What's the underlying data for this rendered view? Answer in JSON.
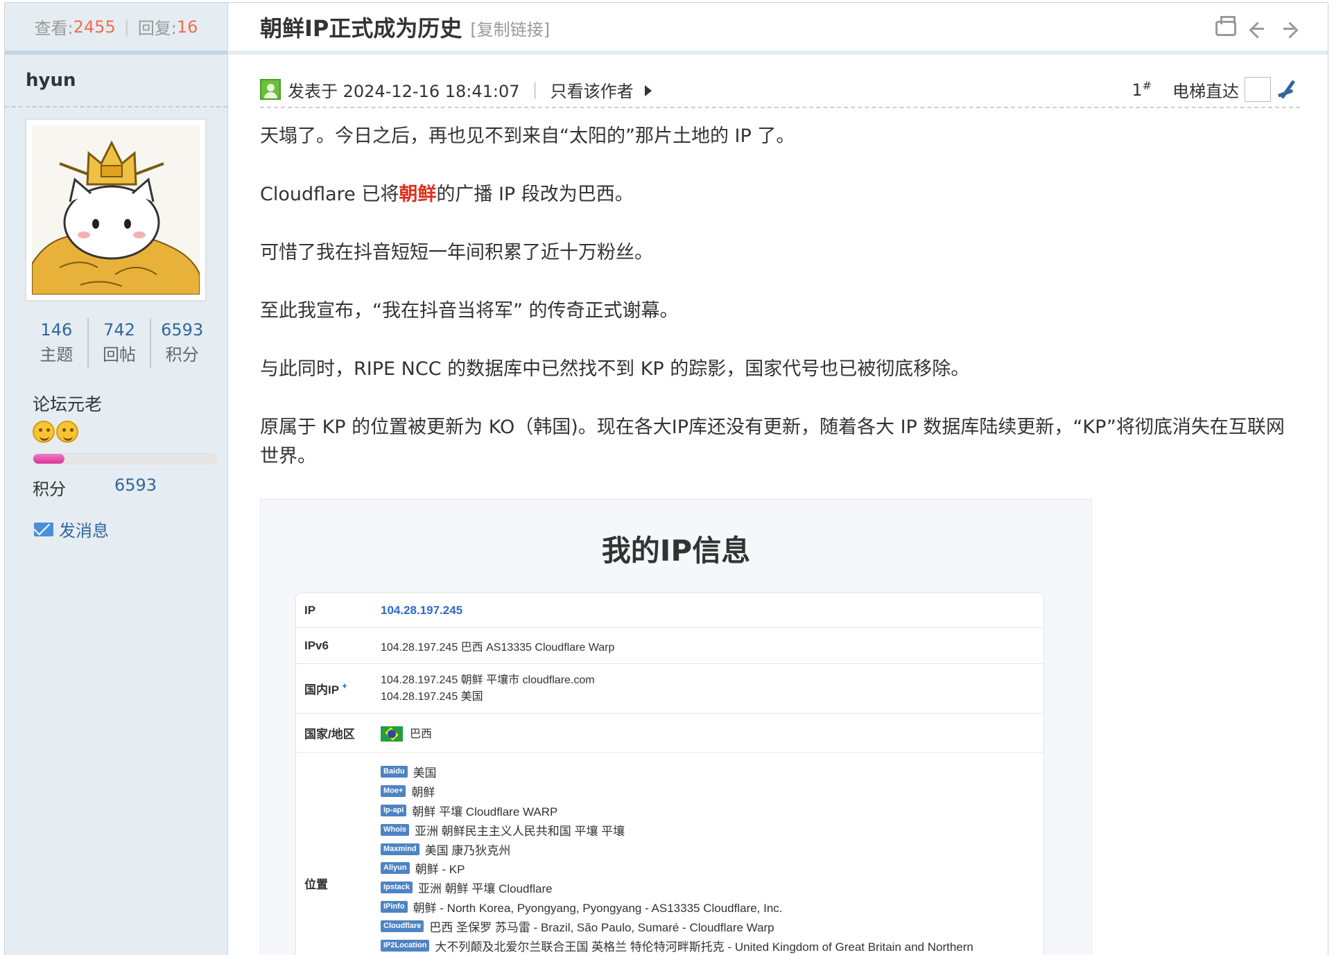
{
  "sidebar": {
    "views_label": "查看:",
    "views": "2455",
    "replies_label": "回复:",
    "replies": "16",
    "author": "hyun",
    "counts": [
      {
        "n": "146",
        "l": "主题"
      },
      {
        "n": "742",
        "l": "回帖"
      },
      {
        "n": "6593",
        "l": "积分"
      }
    ],
    "rank": "论坛元老",
    "progress_fraction": 0.17,
    "points_label": "积分",
    "points": "6593",
    "send_message": "发消息"
  },
  "thread": {
    "title": "朝鲜IP正式成为历史",
    "copy_link": "[复制链接]"
  },
  "post": {
    "time": "发表于 2024-12-16 18:41:07",
    "separator": "|",
    "author_only": "只看该作者",
    "floor": "1",
    "floor_mark": "#",
    "jump_label": "电梯直达",
    "paragraphs": {
      "p1": "天塌了。今日之后，再也见不到来自“太阳的”那片土地的 IP 了。",
      "p2a": "Cloudflare 已将",
      "p2b": "朝鲜",
      "p2c": "的广播 IP 段改为巴西。",
      "p3": "可惜了我在抖音短短一年间积累了近十万粉丝。",
      "p4": "至此我宣布，“我在抖音当将军” 的传奇正式谢幕。",
      "p5": "与此同时，RIPE NCC 的数据库中已然找不到 KP 的踪影，国家代号也已被彻底移除。",
      "p6": "原属于 KP 的位置被更新为 KO（韩国)。现在各大IP库还没有更新，随着各大 IP 数据库陆续更新，“KP”将彻底消失在互联网世界。"
    }
  },
  "ipinfo": {
    "heading": "我的IP信息",
    "rows": {
      "ip_k": "IP",
      "ip_v": "104.28.197.245",
      "ipv6_k": "IPv6",
      "ipv6_v": "104.28.197.245 巴西 AS13335 Cloudflare Warp",
      "domestic_k": "国内IP",
      "domestic_plus": "+",
      "domestic_v1": "104.28.197.245 朝鲜 平壤市 cloudflare.com",
      "domestic_v2": "104.28.197.245 美国",
      "country_k": "国家/地区",
      "country_v": "巴西",
      "location_k": "位置"
    },
    "locations": [
      {
        "tag": "Baidu",
        "text": "美国"
      },
      {
        "tag": "Moe+",
        "text": "朝鲜"
      },
      {
        "tag": "Ip-api",
        "text": "朝鲜 平壤 Cloudflare WARP"
      },
      {
        "tag": "Whois",
        "text": "亚洲 朝鲜民主主义人民共和国 平壤 平壤"
      },
      {
        "tag": "Maxmind",
        "text": "美国 康乃狄克州"
      },
      {
        "tag": "Aliyun",
        "text": "朝鲜 - KP"
      },
      {
        "tag": "Ipstack",
        "text": "亚洲 朝鲜 平壤 Cloudflare"
      },
      {
        "tag": "IPinfo",
        "text": "朝鲜 - North Korea, Pyongyang, Pyongyang - AS13335 Cloudflare, Inc."
      },
      {
        "tag": "Cloudflare",
        "text": "巴西 圣保罗 苏马雷 - Brazil, São Paulo, Sumaré - Cloudflare Warp"
      },
      {
        "tag": "IP2Location",
        "text": "大不列颠及北爱尔兰联合王国 英格兰 特伦特河畔斯托克 - United Kingdom of Great Britain and Northern"
      }
    ]
  }
}
